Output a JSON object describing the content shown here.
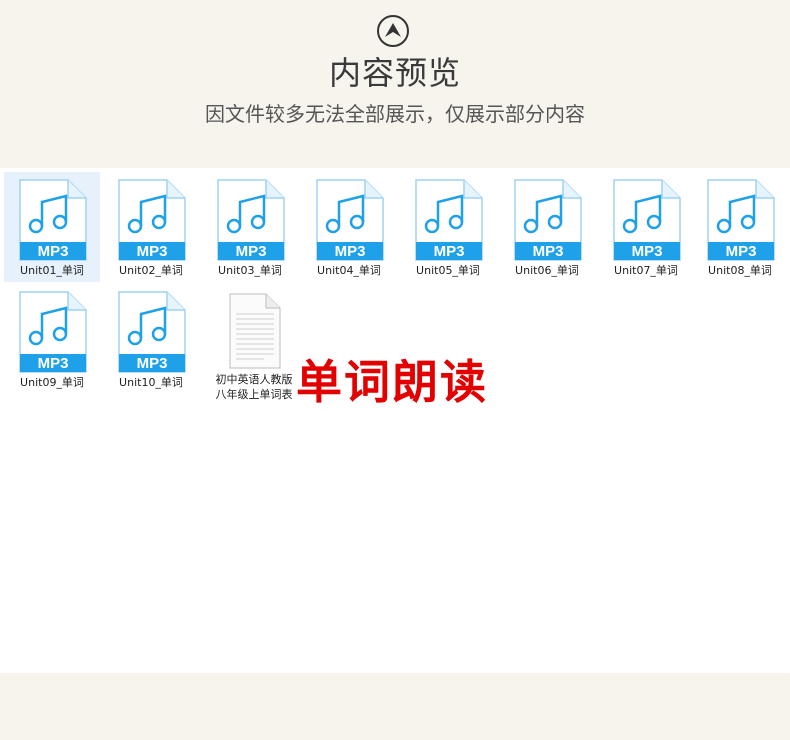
{
  "header": {
    "icon": "up-arrow-circle-icon",
    "title": "内容预览",
    "subtitle": "因文件较多无法全部展示，仅展示部分内容"
  },
  "files": [
    {
      "name": "Unit01_单词",
      "badge": "MP3",
      "selected": true
    },
    {
      "name": "Unit02_单词",
      "badge": "MP3"
    },
    {
      "name": "Unit03_单词",
      "badge": "MP3"
    },
    {
      "name": "Unit04_单词",
      "badge": "MP3"
    },
    {
      "name": "Unit05_单词",
      "badge": "MP3"
    },
    {
      "name": "Unit06_单词",
      "badge": "MP3"
    },
    {
      "name": "Unit07_单词",
      "badge": "MP3"
    },
    {
      "name": "Unit08_单词",
      "badge": "MP3"
    },
    {
      "name": "Unit09_单词",
      "badge": "MP3"
    },
    {
      "name": "Unit10_单词",
      "badge": "MP3"
    }
  ],
  "document": {
    "name_line1": "初中英语人教版",
    "name_line2": "八年级上单词表",
    "icon": "document-icon"
  },
  "overlay_label": "单词朗读",
  "colors": {
    "background": "#f7f4ee",
    "mp3_blue": "#1ea1e8",
    "label_red": "#e30000"
  }
}
